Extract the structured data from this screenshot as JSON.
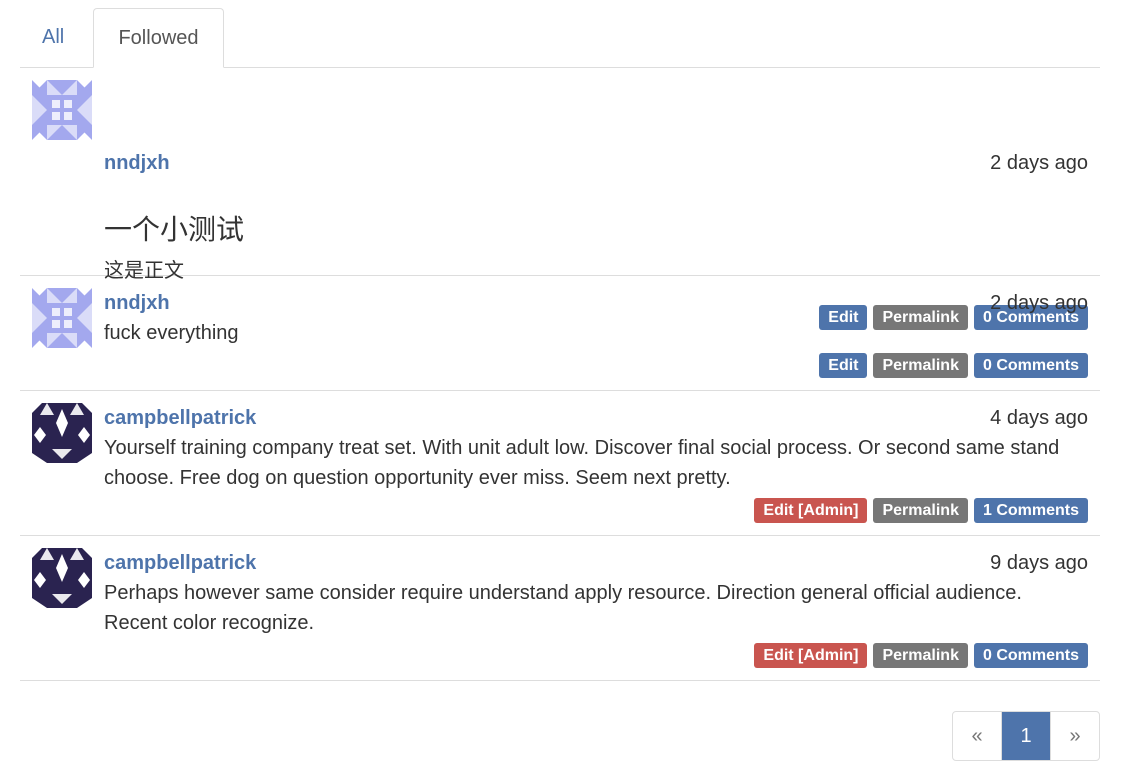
{
  "tabs": [
    {
      "label": "All",
      "active": false
    },
    {
      "label": "Followed",
      "active": true
    }
  ],
  "posts": [
    {
      "author": "nndjxh",
      "time": "2 days ago",
      "title": "一个小测试",
      "body": "这是正文",
      "avatar": "identicon-lavender",
      "actions": {
        "edit": "Edit",
        "permalink": "Permalink",
        "comments": "0 Comments"
      }
    },
    {
      "author": "nndjxh",
      "time": "2 days ago",
      "body": "fuck everything",
      "avatar": "identicon-lavender",
      "actions": {
        "edit": "Edit",
        "permalink": "Permalink",
        "comments": "0 Comments"
      }
    },
    {
      "author": "campbellpatrick",
      "time": "4 days ago",
      "body": "Yourself training company treat set. With unit adult low. Discover final social process. Or second same stand choose. Free dog on question opportunity ever miss. Seem next pretty.",
      "avatar": "identicon-navy",
      "actions": {
        "edit": "Edit [Admin]",
        "permalink": "Permalink",
        "comments": "1 Comments"
      }
    },
    {
      "author": "campbellpatrick",
      "time": "9 days ago",
      "body": "Perhaps however same consider require understand apply resource. Direction general official audience. Recent color recognize.",
      "avatar": "identicon-navy",
      "actions": {
        "edit": "Edit [Admin]",
        "permalink": "Permalink",
        "comments": "0 Comments"
      }
    }
  ],
  "pagination": {
    "prev": "«",
    "current": "1",
    "next": "»"
  },
  "colors": {
    "link": "#4e74ab",
    "admin": "#c9554f",
    "neutral": "#777777",
    "avatar_lavender": "#a3a8ee",
    "avatar_navy": "#2a2350"
  }
}
